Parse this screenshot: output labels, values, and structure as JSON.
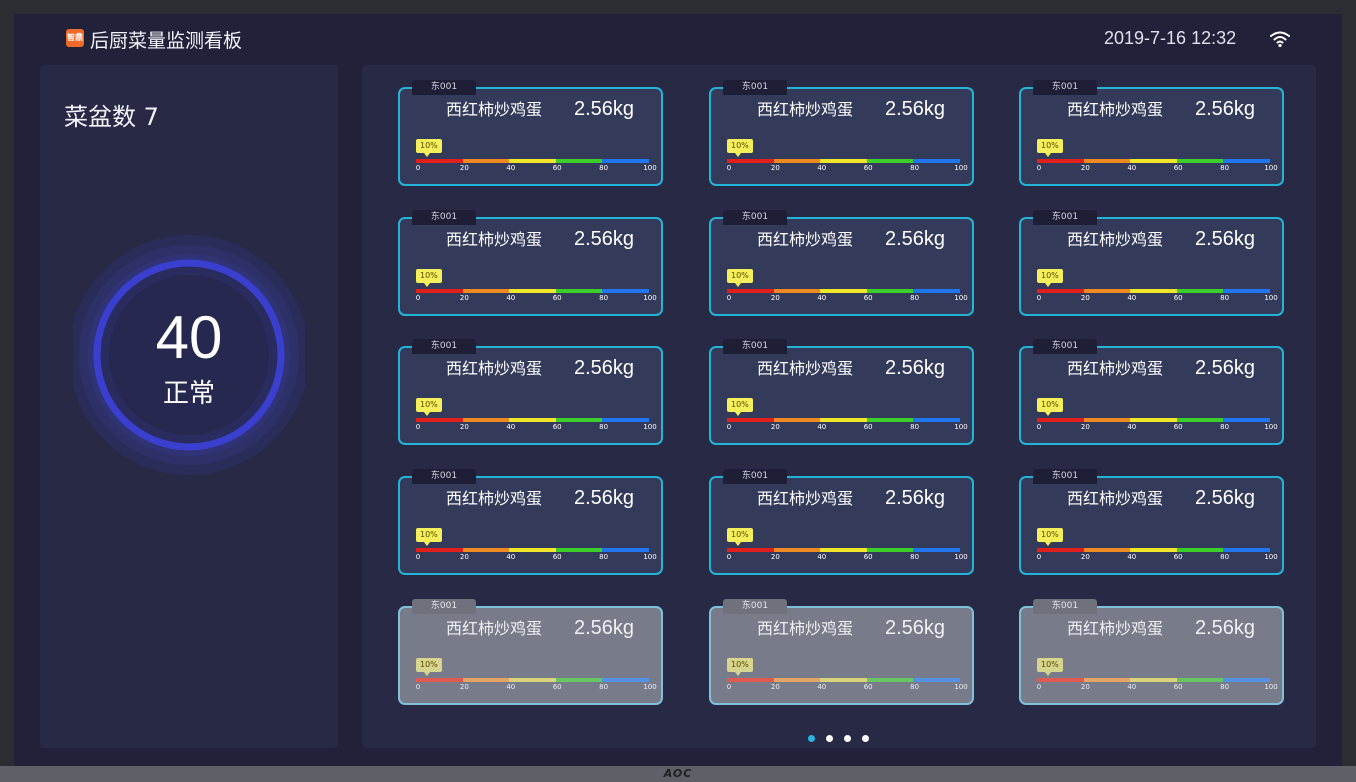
{
  "header": {
    "logo_text": "智鼎",
    "title": "后厨菜量监测看板",
    "datetime": "2019-7-16 12:32"
  },
  "summary": {
    "count_label": "菜盆数 7",
    "gauge_value": "40",
    "gauge_status": "正常",
    "gauge_level": 0.4
  },
  "scale_ticks": [
    "0",
    "20",
    "40",
    "60",
    "80",
    "100"
  ],
  "cards": [
    {
      "tag": "东001",
      "name": "西红柿炒鸡蛋",
      "weight": "2.56kg",
      "percent": "10%",
      "dim": false
    },
    {
      "tag": "东001",
      "name": "西红柿炒鸡蛋",
      "weight": "2.56kg",
      "percent": "10%",
      "dim": false
    },
    {
      "tag": "东001",
      "name": "西红柿炒鸡蛋",
      "weight": "2.56kg",
      "percent": "10%",
      "dim": false
    },
    {
      "tag": "东001",
      "name": "西红柿炒鸡蛋",
      "weight": "2.56kg",
      "percent": "10%",
      "dim": false
    },
    {
      "tag": "东001",
      "name": "西红柿炒鸡蛋",
      "weight": "2.56kg",
      "percent": "10%",
      "dim": false
    },
    {
      "tag": "东001",
      "name": "西红柿炒鸡蛋",
      "weight": "2.56kg",
      "percent": "10%",
      "dim": false
    },
    {
      "tag": "东001",
      "name": "西红柿炒鸡蛋",
      "weight": "2.56kg",
      "percent": "10%",
      "dim": false
    },
    {
      "tag": "东001",
      "name": "西红柿炒鸡蛋",
      "weight": "2.56kg",
      "percent": "10%",
      "dim": false
    },
    {
      "tag": "东001",
      "name": "西红柿炒鸡蛋",
      "weight": "2.56kg",
      "percent": "10%",
      "dim": false
    },
    {
      "tag": "东001",
      "name": "西红柿炒鸡蛋",
      "weight": "2.56kg",
      "percent": "10%",
      "dim": false
    },
    {
      "tag": "东001",
      "name": "西红柿炒鸡蛋",
      "weight": "2.56kg",
      "percent": "10%",
      "dim": false
    },
    {
      "tag": "东001",
      "name": "西红柿炒鸡蛋",
      "weight": "2.56kg",
      "percent": "10%",
      "dim": false
    },
    {
      "tag": "东001",
      "name": "西红柿炒鸡蛋",
      "weight": "2.56kg",
      "percent": "10%",
      "dim": true
    },
    {
      "tag": "东001",
      "name": "西红柿炒鸡蛋",
      "weight": "2.56kg",
      "percent": "10%",
      "dim": true
    },
    {
      "tag": "东001",
      "name": "西红柿炒鸡蛋",
      "weight": "2.56kg",
      "percent": "10%",
      "dim": true
    }
  ],
  "pagination": {
    "total": 4,
    "active": 0
  },
  "monitor_brand": "AOC",
  "colors": {
    "accent": "#23b4d8",
    "gauge_ring": "#3b3fd0",
    "scale": [
      "#e2201b",
      "#ef8a22",
      "#f0e72a",
      "#3ccf2c",
      "#1f76ee"
    ]
  }
}
